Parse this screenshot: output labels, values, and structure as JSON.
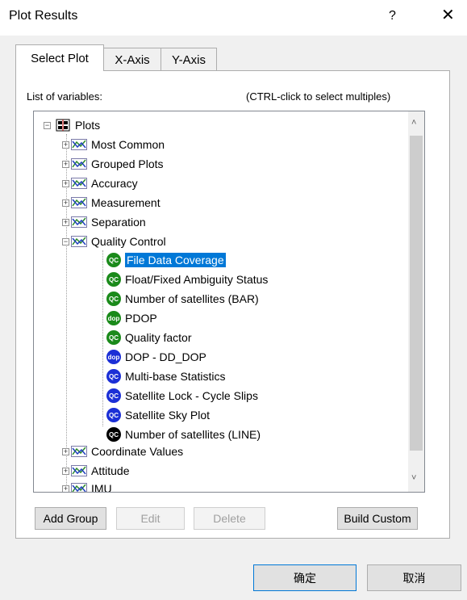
{
  "window": {
    "title": "Plot Results",
    "help": "?",
    "close": "✕"
  },
  "tabs": [
    {
      "label": "Select Plot",
      "active": true
    },
    {
      "label": "X-Axis",
      "active": false
    },
    {
      "label": "Y-Axis",
      "active": false
    }
  ],
  "list": {
    "label": "List of variables:",
    "hint": "(CTRL-click to select multiples)"
  },
  "tree": {
    "root": {
      "label": "Plots",
      "expander": "−"
    },
    "groups": [
      {
        "label": "Most Common",
        "expander": "+"
      },
      {
        "label": "Grouped Plots",
        "expander": "+"
      },
      {
        "label": "Accuracy",
        "expander": "+"
      },
      {
        "label": "Measurement",
        "expander": "+"
      },
      {
        "label": "Separation",
        "expander": "+"
      },
      {
        "label": "Quality Control",
        "expander": "−"
      }
    ],
    "qc_items": [
      {
        "label": "File Data Coverage",
        "badge": "QC",
        "color": "#1a8a1a",
        "selected": true
      },
      {
        "label": "Float/Fixed Ambiguity Status",
        "badge": "QC",
        "color": "#1a8a1a"
      },
      {
        "label": "Number of satellites (BAR)",
        "badge": "QC",
        "color": "#1a8a1a"
      },
      {
        "label": "PDOP",
        "badge": "dop",
        "color": "#1a8a1a"
      },
      {
        "label": "Quality factor",
        "badge": "QC",
        "color": "#1a8a1a"
      },
      {
        "label": "DOP - DD_DOP",
        "badge": "dop",
        "color": "#1b2fd6"
      },
      {
        "label": "Multi-base Statistics",
        "badge": "QC",
        "color": "#1b2fd6"
      },
      {
        "label": "Satellite Lock - Cycle Slips",
        "badge": "QC",
        "color": "#1b2fd6"
      },
      {
        "label": "Satellite Sky Plot",
        "badge": "QC",
        "color": "#1b2fd6"
      },
      {
        "label": "Number of satellites (LINE)",
        "badge": "QC",
        "color": "#000000"
      }
    ],
    "tail_groups": [
      {
        "label": "Coordinate Values",
        "expander": "+"
      },
      {
        "label": "Attitude",
        "expander": "+"
      },
      {
        "label": "IMU",
        "expander": "+"
      }
    ],
    "scroll_up": "˄",
    "scroll_down": "˅"
  },
  "buttons": {
    "add_group": "Add Group",
    "edit": "Edit",
    "delete": "Delete",
    "build_custom": "Build Custom",
    "ok": "确定",
    "cancel": "取消"
  },
  "colors": {
    "selection": "#0078d7",
    "qc_green": "#1a8a1a",
    "qc_blue": "#1b2fd6",
    "qc_black": "#000000"
  }
}
